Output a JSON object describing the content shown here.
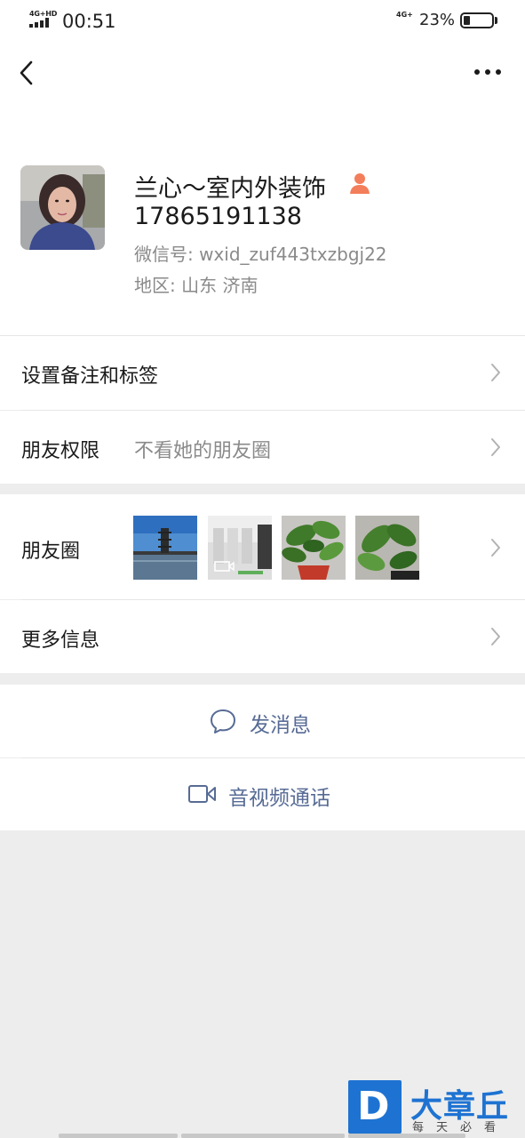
{
  "status_bar": {
    "network_left": "4G+HD",
    "time": "00:51",
    "network_right": "4G+",
    "battery_percent": "23%",
    "battery_level": 0.23
  },
  "nav": {
    "back_icon": "chevron-left-icon",
    "more_icon": "more-dots-icon"
  },
  "profile": {
    "name": "兰心～室内外装饰",
    "phone": "17865191138",
    "wechat_id_label": "微信号:",
    "wechat_id": "wxid_zuf443txzbgj22",
    "region_label": "地区:",
    "region_province": "山东",
    "region_city": "济南",
    "gender_icon": "female-icon",
    "gender_color": "#f37e5b"
  },
  "rows": {
    "remark": {
      "label": "设置备注和标签"
    },
    "permission": {
      "label": "朋友权限",
      "value": "不看她的朋友圈"
    },
    "moments": {
      "label": "朋友圈"
    },
    "more_info": {
      "label": "更多信息"
    }
  },
  "actions": {
    "message": {
      "label": "发消息",
      "icon": "chat-bubble-icon"
    },
    "call": {
      "label": "音视频通话",
      "icon": "video-camera-icon"
    }
  },
  "watermark": {
    "logo_letter": "D",
    "title": "大章丘",
    "subtitle": "每天必看"
  },
  "colors": {
    "link": "#576b95",
    "secondary_text": "#8a8a8a",
    "background": "#ededed",
    "watermark_blue": "#1e73d2"
  }
}
